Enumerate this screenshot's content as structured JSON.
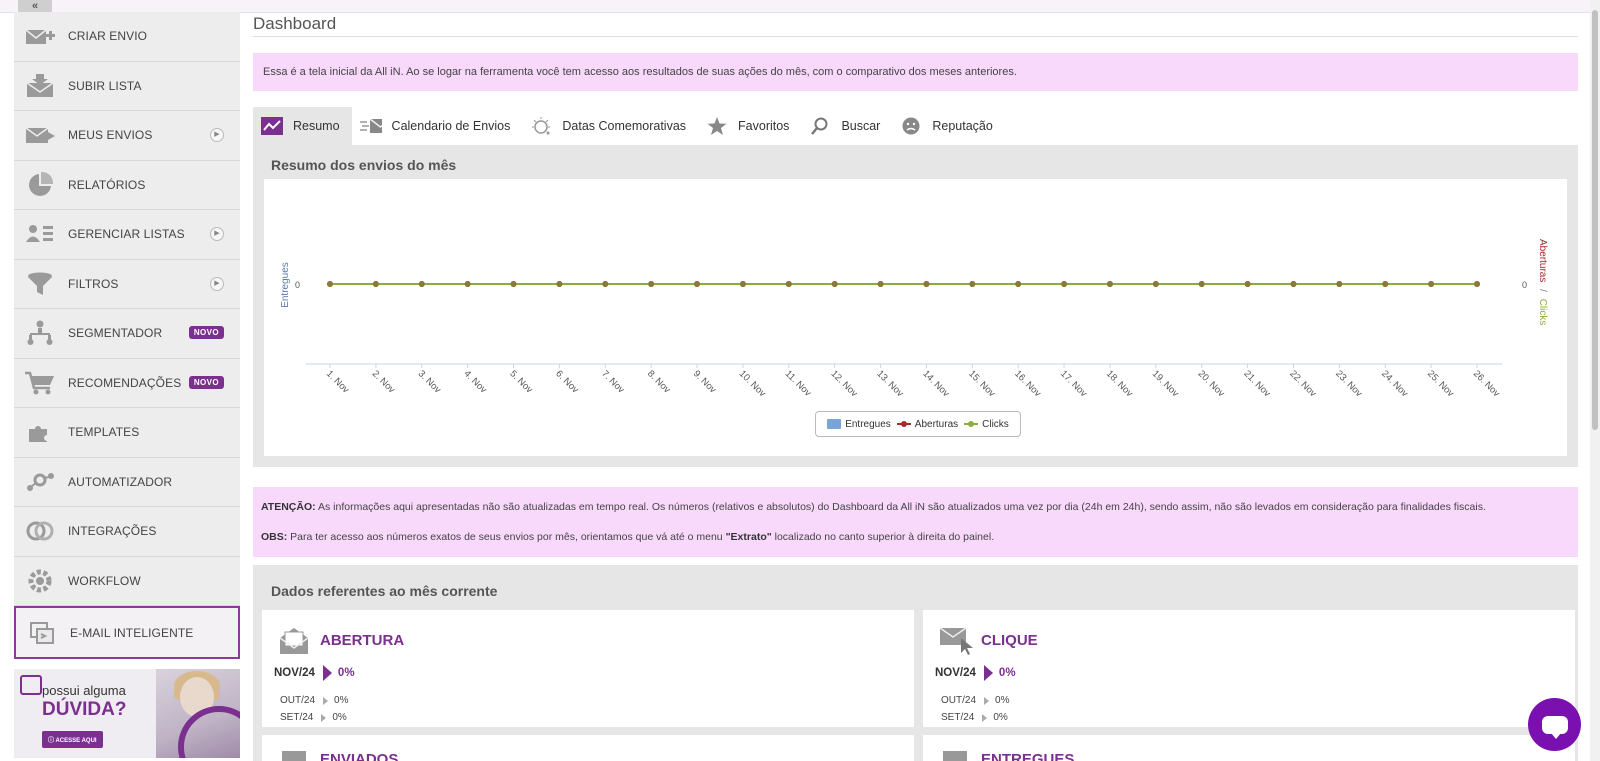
{
  "sidebar": {
    "collapse_label": "«",
    "items": [
      {
        "label": "CRIAR ENVIO",
        "icon": "create-mail-icon"
      },
      {
        "label": "SUBIR LISTA",
        "icon": "upload-list-icon"
      },
      {
        "label": "MEUS ENVIOS",
        "icon": "my-sends-icon",
        "has_arrow": true
      },
      {
        "label": "RELATÓRIOS",
        "icon": "pie-chart-icon"
      },
      {
        "label": "GERENCIAR LISTAS",
        "icon": "manage-lists-icon",
        "has_arrow": true
      },
      {
        "label": "FILTROS",
        "icon": "funnel-icon",
        "has_arrow": true
      },
      {
        "label": "SEGMENTADOR",
        "icon": "segment-icon",
        "badge": "NOVO"
      },
      {
        "label": "RECOMENDAÇÕES",
        "icon": "cart-icon",
        "badge": "NOVO"
      },
      {
        "label": "TEMPLATES",
        "icon": "puzzle-icon"
      },
      {
        "label": "AUTOMATIZADOR",
        "icon": "automation-icon"
      },
      {
        "label": "INTEGRAÇÕES",
        "icon": "integration-icon"
      },
      {
        "label": "WORKFLOW",
        "icon": "workflow-icon"
      },
      {
        "label": "E-MAIL INTELIGENTE",
        "icon": "smart-email-icon",
        "active": true
      }
    ],
    "promo": {
      "line1": "possui alguma",
      "line2": "DÚVIDA?",
      "button": "ⓘ ACESSE AQUI"
    }
  },
  "page": {
    "title": "Dashboard",
    "intro": "Essa é a tela inicial da All iN. Ao se logar na ferramenta você tem acesso aos resultados de suas ações do mês, com o comparativo dos meses anteriores."
  },
  "tabs": [
    {
      "label": "Resumo",
      "icon": "trend-icon",
      "active": true
    },
    {
      "label": "Calendario de Envios",
      "icon": "mail-speed-icon"
    },
    {
      "label": "Datas Comemorativas",
      "icon": "celebration-icon"
    },
    {
      "label": "Favoritos",
      "icon": "star-icon"
    },
    {
      "label": "Buscar",
      "icon": "search-icon"
    },
    {
      "label": "Reputação",
      "icon": "reputation-icon"
    }
  ],
  "chart_panel_title": "Resumo dos envios do mês",
  "chart_data": {
    "type": "line",
    "categories": [
      "1. Nov",
      "2. Nov",
      "3. Nov",
      "4. Nov",
      "5. Nov",
      "6. Nov",
      "7. Nov",
      "8. Nov",
      "9. Nov",
      "10. Nov",
      "11. Nov",
      "12. Nov",
      "13. Nov",
      "14. Nov",
      "15. Nov",
      "16. Nov",
      "17. Nov",
      "18. Nov",
      "19. Nov",
      "20. Nov",
      "21. Nov",
      "22. Nov",
      "23. Nov",
      "24. Nov",
      "25. Nov",
      "26. Nov"
    ],
    "series": [
      {
        "name": "Entregues",
        "values": [
          0,
          0,
          0,
          0,
          0,
          0,
          0,
          0,
          0,
          0,
          0,
          0,
          0,
          0,
          0,
          0,
          0,
          0,
          0,
          0,
          0,
          0,
          0,
          0,
          0,
          0
        ],
        "color": "#7aa4d8"
      },
      {
        "name": "Aberturas",
        "values": [
          0,
          0,
          0,
          0,
          0,
          0,
          0,
          0,
          0,
          0,
          0,
          0,
          0,
          0,
          0,
          0,
          0,
          0,
          0,
          0,
          0,
          0,
          0,
          0,
          0,
          0
        ],
        "color": "#a52a2a"
      },
      {
        "name": "Clicks",
        "values": [
          0,
          0,
          0,
          0,
          0,
          0,
          0,
          0,
          0,
          0,
          0,
          0,
          0,
          0,
          0,
          0,
          0,
          0,
          0,
          0,
          0,
          0,
          0,
          0,
          0,
          0
        ],
        "color": "#8bad3c"
      }
    ],
    "ylabel_left": "Entregues",
    "ylabel_right_a": "Aberturas",
    "ylabel_right_sep": "/",
    "ylabel_right_b": "Clicks",
    "ytick_left": "0",
    "ytick_right": "0",
    "legend": "bottom-center"
  },
  "notice": {
    "attention_label": "ATENÇÃO:",
    "attention_text": " As informações aqui apresentadas não são atualizadas em tempo real. Os números (relativos e absolutos) do Dashboard da All iN são atualizados uma vez por dia (24h em 24h), sendo assim, não são levados em consideração para finalidades fiscais.",
    "obs_label": "OBS:",
    "obs_text_1": " Para ter acesso aos números exatos de seus envios por mês, orientamos que vá até o menu ",
    "obs_extrato": "\"Extrato\"",
    "obs_text_2": " localizado no canto superior à direita do painel."
  },
  "stats": {
    "title": "Dados referentes ao mês corrente",
    "cards": [
      {
        "title": "ABERTURA",
        "icon": "open-mail-icon",
        "main_month": "NOV/24",
        "main_value": "0%",
        "prev": [
          {
            "month": "OUT/24",
            "value": "0%"
          },
          {
            "month": "SET/24",
            "value": "0%"
          }
        ]
      },
      {
        "title": "CLIQUE",
        "icon": "mail-click-icon",
        "main_month": "NOV/24",
        "main_value": "0%",
        "prev": [
          {
            "month": "OUT/24",
            "value": "0%"
          },
          {
            "month": "SET/24",
            "value": "0%"
          }
        ]
      },
      {
        "title": "ENVIADOS",
        "icon": "sent-icon"
      },
      {
        "title": "ENTREGUES",
        "icon": "delivered-icon"
      }
    ]
  },
  "colors": {
    "brand": "#7b2f8f",
    "info_bg": "#f8d8fb",
    "panel_bg": "#e6e6e6",
    "chat": "#7a10b0"
  }
}
